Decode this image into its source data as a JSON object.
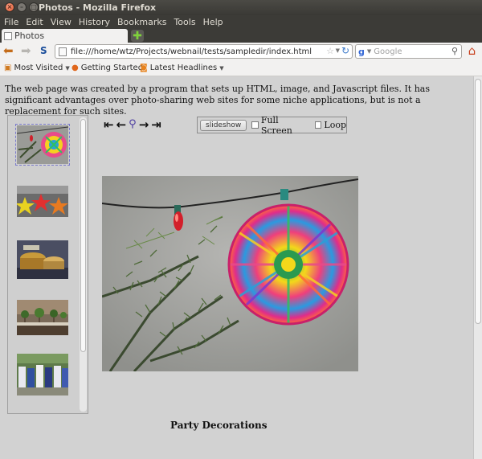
{
  "window": {
    "title": "Photos - Mozilla Firefox"
  },
  "menu": [
    "File",
    "Edit",
    "View",
    "History",
    "Bookmarks",
    "Tools",
    "Help"
  ],
  "tab": {
    "label": "Photos",
    "new_tab_symbol": "✚"
  },
  "nav": {
    "url": "file:///home/wtz/Projects/webnail/tests/sampledir/index.html",
    "search_placeholder": "Google"
  },
  "bookmarks": [
    {
      "label": "Most Visited",
      "icon": "bookmarks-icon",
      "dropdown": true
    },
    {
      "label": "Getting Started",
      "icon": "firefox-icon",
      "dropdown": false
    },
    {
      "label": "Latest Headlines",
      "icon": "rss-icon",
      "dropdown": true
    }
  ],
  "page": {
    "intro": "The web page was created by a program that sets up HTML, image, and Javascript files. It has significant advantages over photo-sharing web sites for some niche applications, but is not a replacement for such sites.",
    "controls": {
      "first": "⇤",
      "prev": "←",
      "zoom": "🔍",
      "next": "→",
      "last": "⇥",
      "slideshow": "slideshow",
      "fullscreen": "Full Screen",
      "loop": "Loop"
    },
    "thumbnails": [
      {
        "name": "thumb-lantern",
        "selected": true
      },
      {
        "name": "thumb-stars",
        "selected": false
      },
      {
        "name": "thumb-pots",
        "selected": false
      },
      {
        "name": "thumb-plants",
        "selected": false
      },
      {
        "name": "thumb-crowd",
        "selected": false
      }
    ],
    "caption": "Party Decorations"
  }
}
